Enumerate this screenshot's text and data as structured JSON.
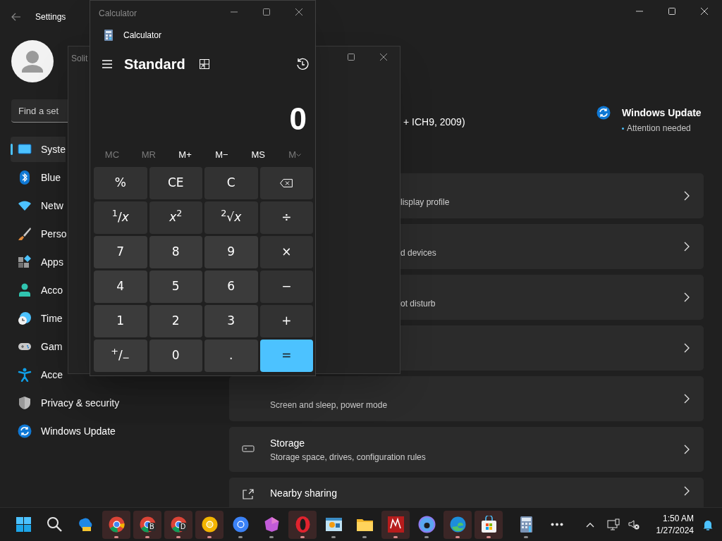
{
  "settings": {
    "title": "Settings",
    "search": {
      "placeholder": "Find a set"
    },
    "nav": [
      {
        "label": "Syste",
        "kind": "monitor",
        "selected": true
      },
      {
        "label": "Blue",
        "kind": "bluetooth",
        "selected": false
      },
      {
        "label": "Netw",
        "kind": "wifi",
        "selected": false
      },
      {
        "label": "Perso",
        "kind": "brush",
        "selected": false
      },
      {
        "label": "Apps",
        "kind": "apps",
        "selected": false
      },
      {
        "label": "Acco",
        "kind": "person",
        "selected": false
      },
      {
        "label": "Time",
        "kind": "clock",
        "selected": false
      },
      {
        "label": "Gam",
        "kind": "gamepad",
        "selected": false
      },
      {
        "label": "Acce",
        "kind": "accessibility",
        "selected": false
      },
      {
        "label": "Privacy & security",
        "kind": "shield",
        "selected": false
      },
      {
        "label": "Windows Update",
        "kind": "sync",
        "selected": false
      }
    ],
    "device_info": "+ ICH9, 2009)",
    "update_badge": {
      "title": "Windows Update",
      "status": "Attention needed"
    },
    "cards": [
      {
        "kind": "partial",
        "subtitle": "lisplay profile"
      },
      {
        "kind": "partial",
        "subtitle": "d devices"
      },
      {
        "kind": "partial",
        "subtitle": "ot disturb"
      },
      {
        "kind": "partial"
      },
      {
        "kind": "full",
        "subtitle": "Screen and sleep, power mode"
      },
      {
        "kind": "drive",
        "title": "Storage",
        "subtitle": "Storage space, drives, configuration rules"
      },
      {
        "kind": "share",
        "title": "Nearby sharing"
      }
    ]
  },
  "solitaire": {
    "title": "Solit"
  },
  "calculator": {
    "title": "Calculator",
    "app_name": "Calculator",
    "mode": "Standard",
    "display": "0",
    "memory": [
      {
        "label": "MC",
        "disabled": true
      },
      {
        "label": "MR",
        "disabled": true
      },
      {
        "label": "M+",
        "disabled": false
      },
      {
        "label": "M−",
        "disabled": false
      },
      {
        "label": "MS",
        "disabled": false
      },
      {
        "label": "M",
        "disabled": true,
        "kind": "dropdown"
      }
    ],
    "keys": [
      {
        "label": "%",
        "kind": "function"
      },
      {
        "label": "CE",
        "kind": "function"
      },
      {
        "label": "C",
        "kind": "function"
      },
      {
        "kind": "backspace"
      },
      {
        "label": "$^{1}$/*x*",
        "kind": "function"
      },
      {
        "label": "*x*$^{2}$",
        "kind": "function"
      },
      {
        "label": "$^{2}$√*x*",
        "kind": "function"
      },
      {
        "label": "÷",
        "kind": "function"
      },
      {
        "label": "7",
        "kind": "digit"
      },
      {
        "label": "8",
        "kind": "digit"
      },
      {
        "label": "9",
        "kind": "digit"
      },
      {
        "label": "×",
        "kind": "function"
      },
      {
        "label": "4",
        "kind": "digit"
      },
      {
        "label": "5",
        "kind": "digit"
      },
      {
        "label": "6",
        "kind": "digit"
      },
      {
        "label": "−",
        "kind": "function"
      },
      {
        "label": "1",
        "kind": "digit"
      },
      {
        "label": "2",
        "kind": "digit"
      },
      {
        "label": "3",
        "kind": "digit"
      },
      {
        "label": "+",
        "kind": "function"
      },
      {
        "label": "$^{+}$/$_{−}$",
        "kind": "digit"
      },
      {
        "label": "0",
        "kind": "digit"
      },
      {
        "label": ".",
        "kind": "digit"
      },
      {
        "label": "=",
        "kind": "equals"
      }
    ]
  },
  "taskbar": {
    "apps": [
      {
        "kind": "start",
        "running": false,
        "flashing": false
      },
      {
        "kind": "search",
        "running": false,
        "flashing": false
      },
      {
        "kind": "cloud",
        "running": false,
        "flashing": false
      },
      {
        "kind": "browser",
        "running": true,
        "flashing": true
      },
      {
        "kind": "browser",
        "badge": "B",
        "running": true,
        "flashing": true
      },
      {
        "kind": "browser",
        "badge": "D",
        "running": true,
        "flashing": true
      },
      {
        "kind": "yellow-browser",
        "running": true,
        "flashing": true
      },
      {
        "kind": "blue-browser",
        "running": true,
        "flashing": false
      },
      {
        "kind": "gem",
        "running": true,
        "flashing": false
      },
      {
        "kind": "ring",
        "running": true,
        "flashing": true
      },
      {
        "kind": "window-app",
        "running": true,
        "flashing": false
      },
      {
        "kind": "folder",
        "running": true,
        "flashing": false
      },
      {
        "kind": "red-tile",
        "running": true,
        "flashing": true
      },
      {
        "kind": "disc",
        "running": true,
        "flashing": false
      },
      {
        "kind": "swirl",
        "running": true,
        "flashing": true
      },
      {
        "kind": "bag",
        "running": true,
        "flashing": true
      },
      {
        "kind": "calculator",
        "running": true,
        "flashing": false
      },
      {
        "kind": "more",
        "running": false,
        "flashing": false
      }
    ],
    "clock": {
      "time": "1:50 AM",
      "date": "1/27/2024"
    }
  }
}
